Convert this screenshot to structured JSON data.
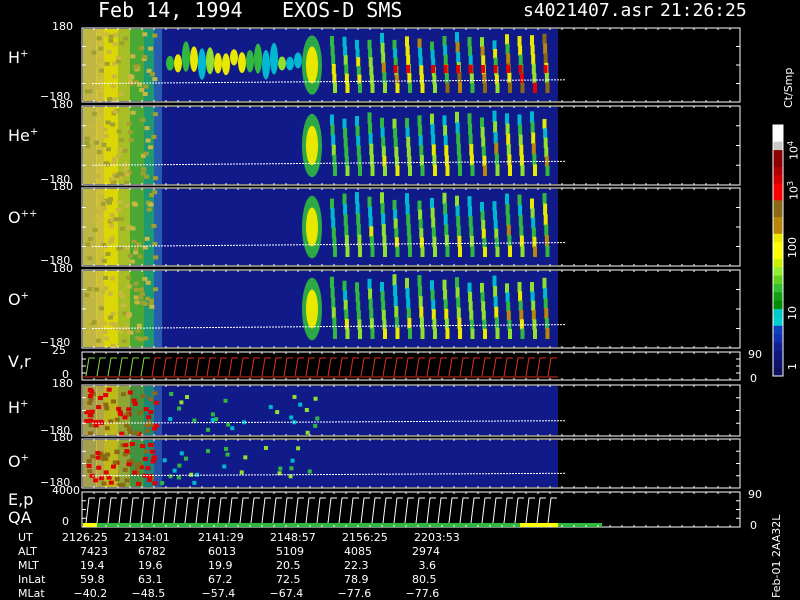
{
  "header": {
    "date": "Feb 14, 1994",
    "instrument": "EXOS-D SMS",
    "file": "s4021407.asr",
    "time": "21:26:25"
  },
  "colorbar": {
    "unit": "Ct/Smp",
    "ticks": [
      "10",
      "10",
      "100",
      "10",
      "1"
    ],
    "tick_sups": [
      "4",
      "3",
      "",
      "",
      ""
    ],
    "colors": [
      "#ffffff",
      "#ffffff",
      "#c8c8c8",
      "#8b0000",
      "#8b0000",
      "#b00000",
      "#d00000",
      "#ff0000",
      "#ff0000",
      "#8b6914",
      "#8b6914",
      "#b8860b",
      "#b8860b",
      "#e8e800",
      "#ffff00",
      "#ffff00",
      "#c8f000",
      "#90ee30",
      "#60d020",
      "#30c030",
      "#10a010",
      "#008c00",
      "#00c8c8",
      "#00d0d0",
      "#1040c0",
      "#1030b0",
      "#102090",
      "#101880",
      "#101470",
      "#101060"
    ]
  },
  "panels": [
    {
      "label": "H",
      "sup": "+",
      "ymax": "180",
      "ymin": "−180"
    },
    {
      "label": "He",
      "sup": "+",
      "ymax": "180",
      "ymin": "−180"
    },
    {
      "label": "O",
      "sup": "++",
      "ymax": "180",
      "ymin": "−180"
    },
    {
      "label": "O",
      "sup": "+",
      "ymax": "180",
      "ymin": "−180"
    },
    {
      "label": "V,r",
      "sup": "",
      "ymax": "25",
      "ymin": "0",
      "rmax": "90",
      "rmin": "0"
    },
    {
      "label": "H",
      "sup": "+",
      "ymax": "180",
      "ymin": "−180"
    },
    {
      "label": "O",
      "sup": "+",
      "ymax": "180",
      "ymin": "−180"
    },
    {
      "label": "E,p",
      "label2": "QA",
      "sup": "",
      "ymax": "4000",
      "ymin": "0",
      "rmax": "90",
      "rmin": "0"
    }
  ],
  "table": {
    "row_labels": [
      "UT",
      "ALT",
      "MLT",
      "InLat",
      "MLat"
    ],
    "columns": [
      [
        "2126:25",
        "7423",
        "19.4",
        "59.8",
        "−40.2"
      ],
      [
        "2134:01",
        "6782",
        "19.6",
        "63.1",
        "−48.5"
      ],
      [
        "2141:29",
        "6013",
        "19.9",
        "67.2",
        "−57.4"
      ],
      [
        "2148:57",
        "5109",
        "20.5",
        "72.5",
        "−67.4"
      ],
      [
        "2156:25",
        "4085",
        "22.3",
        "78.9",
        "−77.6"
      ],
      [
        "2203:53",
        "2974",
        "3.6",
        "80.5",
        "−77.6"
      ]
    ]
  },
  "footer": {
    "id": "Feb-01 2AA32L"
  },
  "chart_data": {
    "type": "heatmap",
    "title": "Feb 14, 1994   EXOS-D SMS",
    "xlabel": "UT",
    "x_ticks": [
      "2126:25",
      "2134:01",
      "2141:29",
      "2148:57",
      "2156:25",
      "2203:53"
    ],
    "colorbar_unit": "Ct/Smp",
    "colorbar_ticks": [
      "10^4",
      "10^3",
      "100",
      "10",
      "1"
    ],
    "panels": [
      "H+",
      "He+",
      "O++",
      "O+",
      "V,r",
      "H+",
      "O+",
      "E,p"
    ],
    "ylim_pitch": [
      -180,
      180
    ],
    "ylim_V": [
      0,
      25
    ],
    "ylim_E": [
      0,
      4000
    ],
    "right_axis": [
      0,
      90
    ]
  }
}
